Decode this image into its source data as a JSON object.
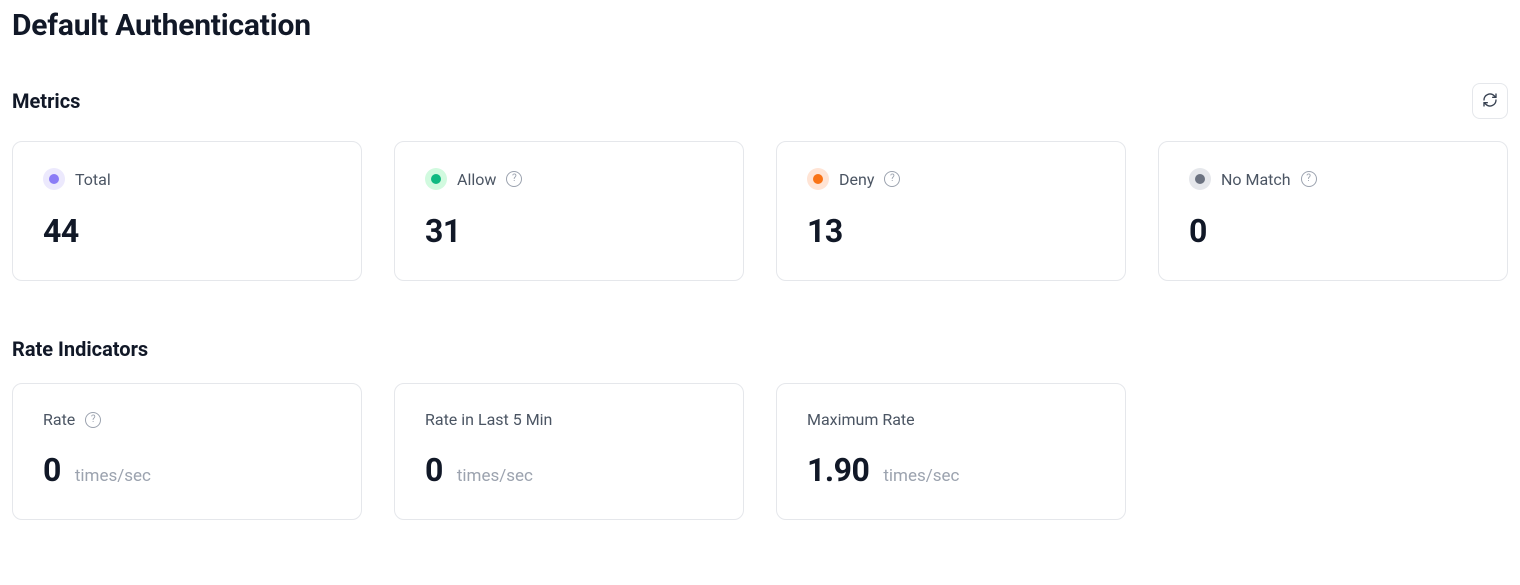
{
  "page": {
    "title": "Default Authentication"
  },
  "metrics": {
    "title": "Metrics",
    "cards": [
      {
        "label": "Total",
        "value": "44",
        "help": false,
        "dot_bg": "#ece9fd",
        "dot_fg": "#8b7cf6"
      },
      {
        "label": "Allow",
        "value": "31",
        "help": true,
        "dot_bg": "#d1fadf",
        "dot_fg": "#10b981"
      },
      {
        "label": "Deny",
        "value": "13",
        "help": true,
        "dot_bg": "#ffe4d5",
        "dot_fg": "#f97316"
      },
      {
        "label": "No Match",
        "value": "0",
        "help": true,
        "dot_bg": "#e5e7eb",
        "dot_fg": "#6b7280"
      }
    ]
  },
  "rates": {
    "title": "Rate Indicators",
    "unit": "times/sec",
    "cards": [
      {
        "label": "Rate",
        "value": "0",
        "help": true
      },
      {
        "label": "Rate in Last 5 Min",
        "value": "0",
        "help": false
      },
      {
        "label": "Maximum Rate",
        "value": "1.90",
        "help": false
      }
    ]
  }
}
